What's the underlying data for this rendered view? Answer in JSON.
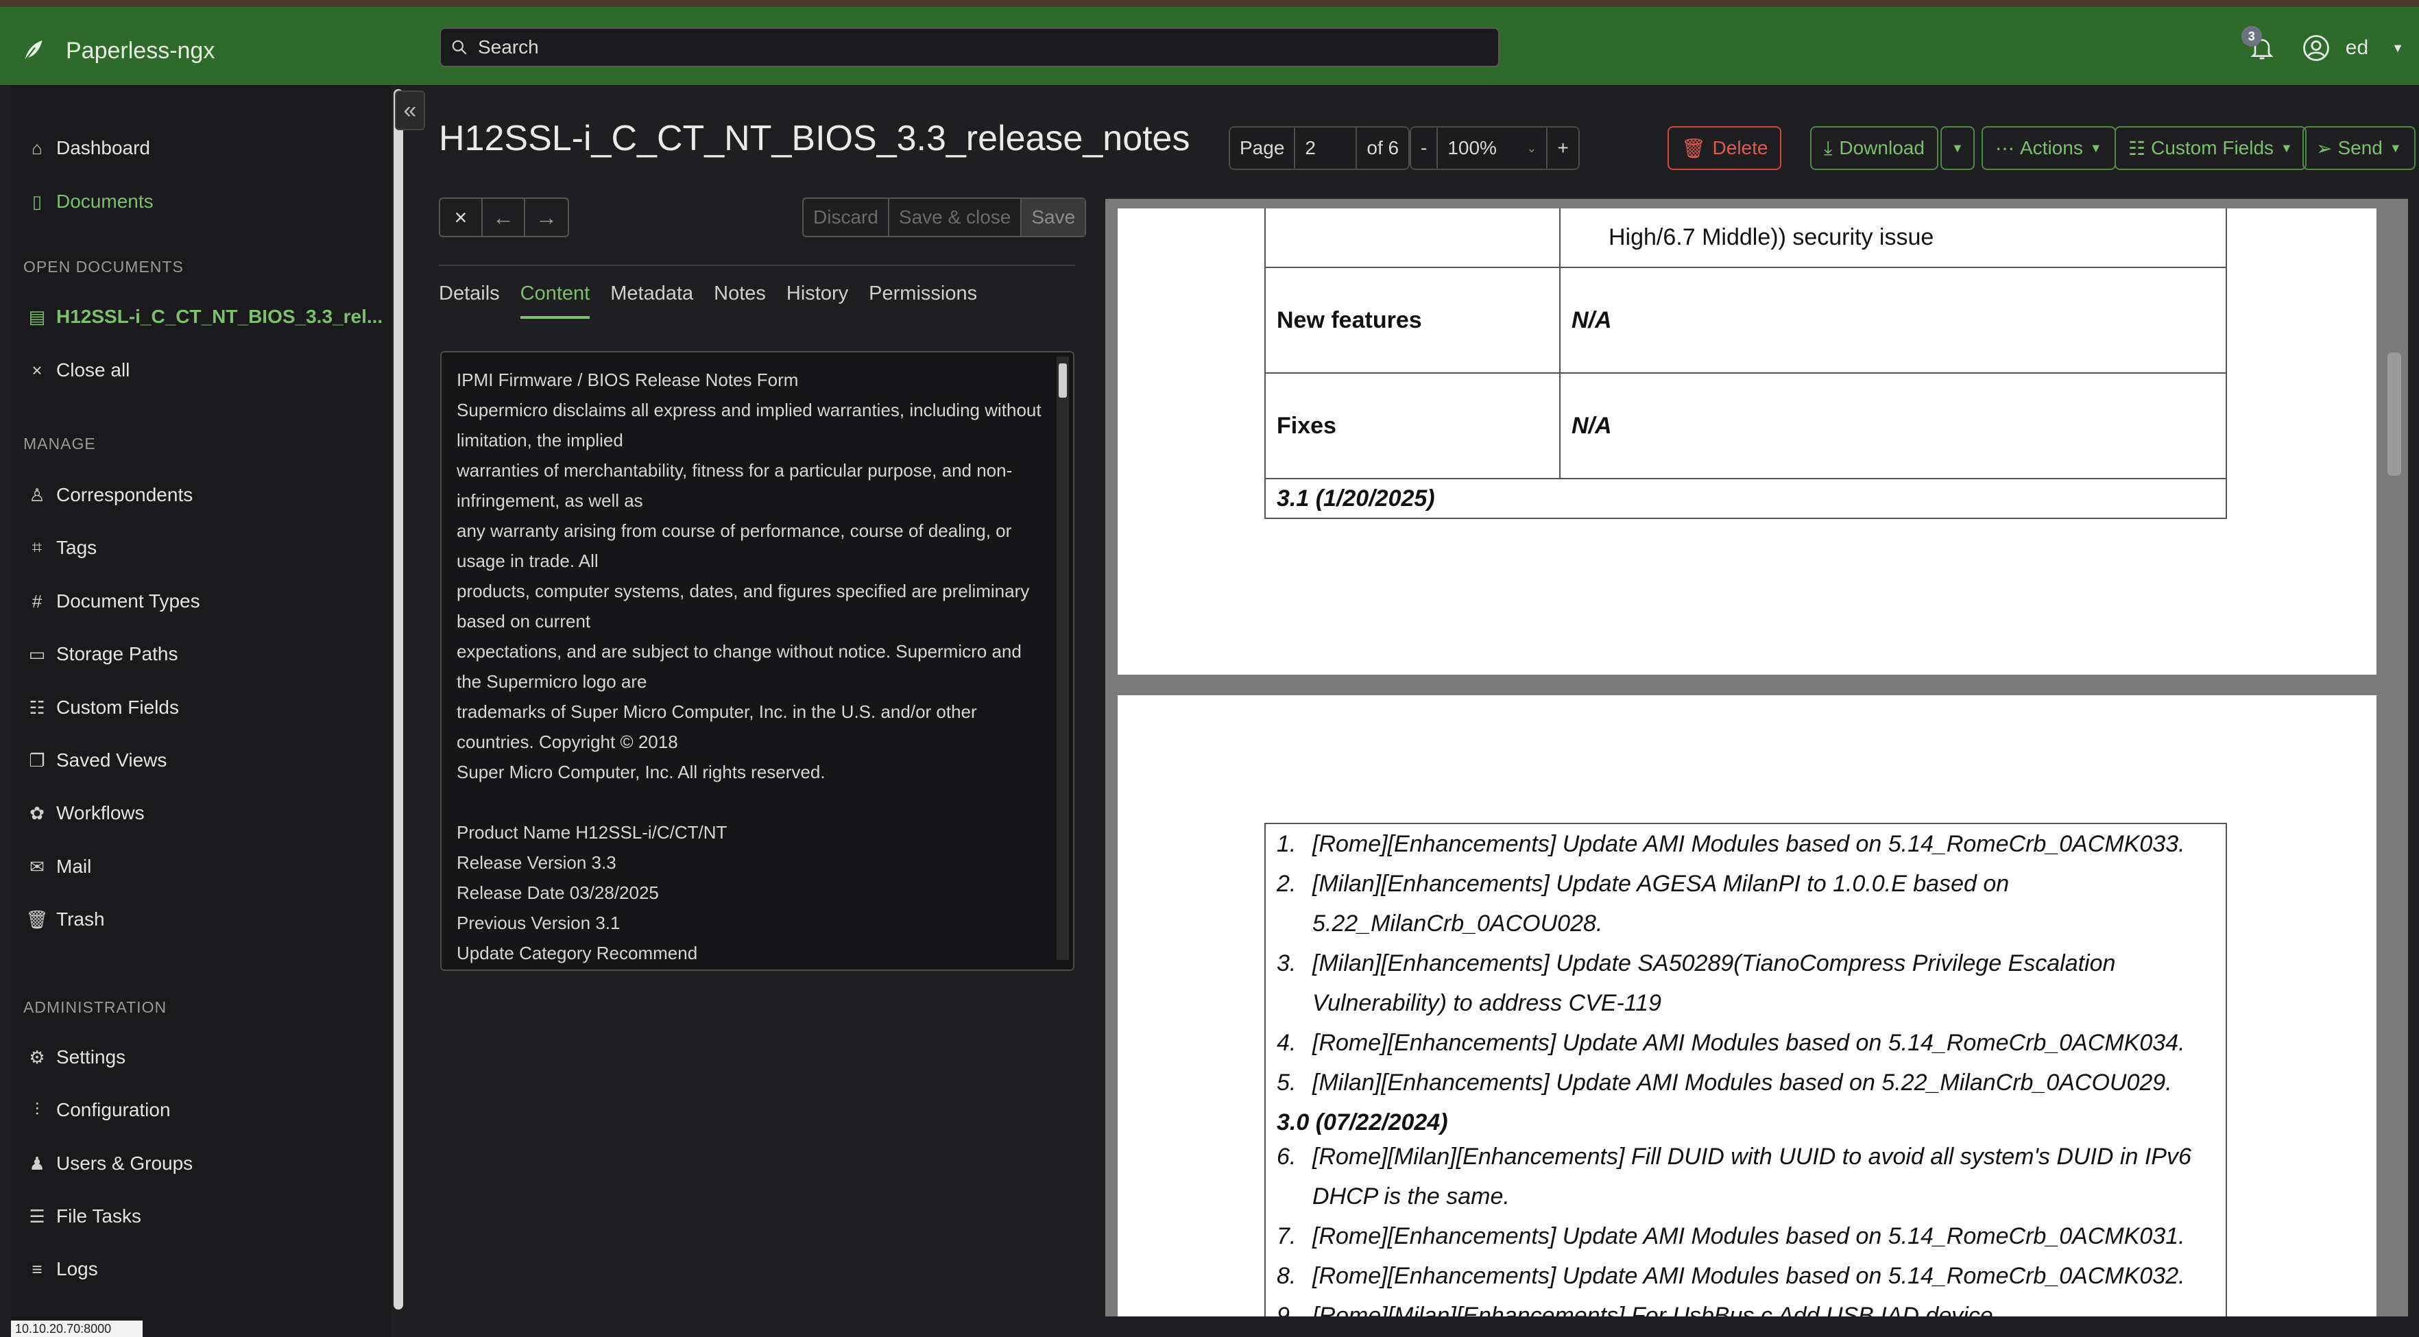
{
  "app": {
    "name": "Paperless-ngx"
  },
  "search": {
    "placeholder": "Search"
  },
  "notifications": {
    "count": "3"
  },
  "user": {
    "name": "ed"
  },
  "sidebar": {
    "dashboard": "Dashboard",
    "documents": "Documents",
    "open_documents_heading": "OPEN DOCUMENTS",
    "open_doc": "H12SSL-i_C_CT_NT_BIOS_3.3_rel...",
    "close_all": "Close all",
    "manage_heading": "MANAGE",
    "manage": [
      "Correspondents",
      "Tags",
      "Document Types",
      "Storage Paths",
      "Custom Fields",
      "Saved Views",
      "Workflows",
      "Mail",
      "Trash"
    ],
    "admin_heading": "ADMINISTRATION",
    "admin": [
      "Settings",
      "Configuration",
      "Users & Groups",
      "File Tasks",
      "Logs"
    ],
    "footer": "10.10.20.70:8000"
  },
  "document": {
    "title": "H12SSL-i_C_CT_NT_BIOS_3.3_release_notes",
    "page_label": "Page",
    "page": "2",
    "page_of": "of 6",
    "zoom": "100%",
    "zoom_minus": "-",
    "zoom_plus": "+"
  },
  "toolbar": {
    "delete": "Delete",
    "download": "Download",
    "actions": "Actions",
    "custom_fields": "Custom Fields",
    "send": "Send",
    "discard": "Discard",
    "save_close": "Save & close",
    "save": "Save"
  },
  "tabs": [
    "Details",
    "Content",
    "Metadata",
    "Notes",
    "History",
    "Permissions"
  ],
  "content": {
    "text": "IPMI Firmware / BIOS Release Notes Form\nSupermicro disclaims all express and implied warranties, including without limitation, the implied\nwarranties of merchantability, fitness for a particular purpose, and non-infringement, as well as\nany warranty arising from course of performance, course of dealing, or usage in trade. All\nproducts, computer systems, dates, and figures specified are preliminary based on current\nexpectations, and are subject to change without notice. Supermicro and the Supermicro logo are\ntrademarks of Super Micro Computer, Inc. in the U.S. and/or other countries. Copyright © 2018\nSuper Micro Computer, Inc. All rights reserved.\n\nProduct Name H12SSL-i/C/CT/NT\nRelease Version 3.3\nRelease Date 03/28/2025\nPrevious Version 3.1\nUpdate Category Recommend\nDependencies None"
  },
  "preview": {
    "top_cell": "High/6.7 Middle)) security issue",
    "row_new_features": "New features",
    "row_fixes": "Fixes",
    "na": "N/A",
    "version_31": "3.1 (1/20/2025)",
    "version_30": "3.0 (07/22/2024)",
    "items": [
      {
        "n": "1.",
        "t": "[Rome][Enhancements] Update AMI Modules based on 5.14_RomeCrb_0ACMK033."
      },
      {
        "n": "2.",
        "t": "[Milan][Enhancements] Update AGESA MilanPI to 1.0.0.E based on",
        "c": "5.22_MilanCrb_0ACOU028."
      },
      {
        "n": "3.",
        "t": "[Milan][Enhancements] Update SA50289(TianoCompress Privilege Escalation",
        "c": "Vulnerability) to address CVE-119"
      },
      {
        "n": "4.",
        "t": "[Rome][Enhancements] Update AMI Modules based on 5.14_RomeCrb_0ACMK034."
      },
      {
        "n": "5.",
        "t": "[Milan][Enhancements] Update AMI Modules based on 5.22_MilanCrb_0ACOU029."
      },
      {
        "n": "6.",
        "t": "[Rome][Milan][Enhancements] Fill DUID with UUID to avoid all system's DUID in IPv6",
        "c": "DHCP is the same."
      },
      {
        "n": "7.",
        "t": "[Rome][Enhancements] Update AMI Modules based on 5.14_RomeCrb_0ACMK031."
      },
      {
        "n": "8.",
        "t": "[Rome][Enhancements] Update AMI Modules based on 5.14_RomeCrb_0ACMK032."
      },
      {
        "n": "9.",
        "t": "[Rome][Milan][Enhancements] For UsbBus.c Add USB IAD device class/subclass/protocol"
      }
    ]
  },
  "colors": {
    "topbar": "#2e6b2b",
    "accent": "#7cc06e",
    "danger": "#d6453a",
    "sidebar": "#1a1a1c"
  }
}
